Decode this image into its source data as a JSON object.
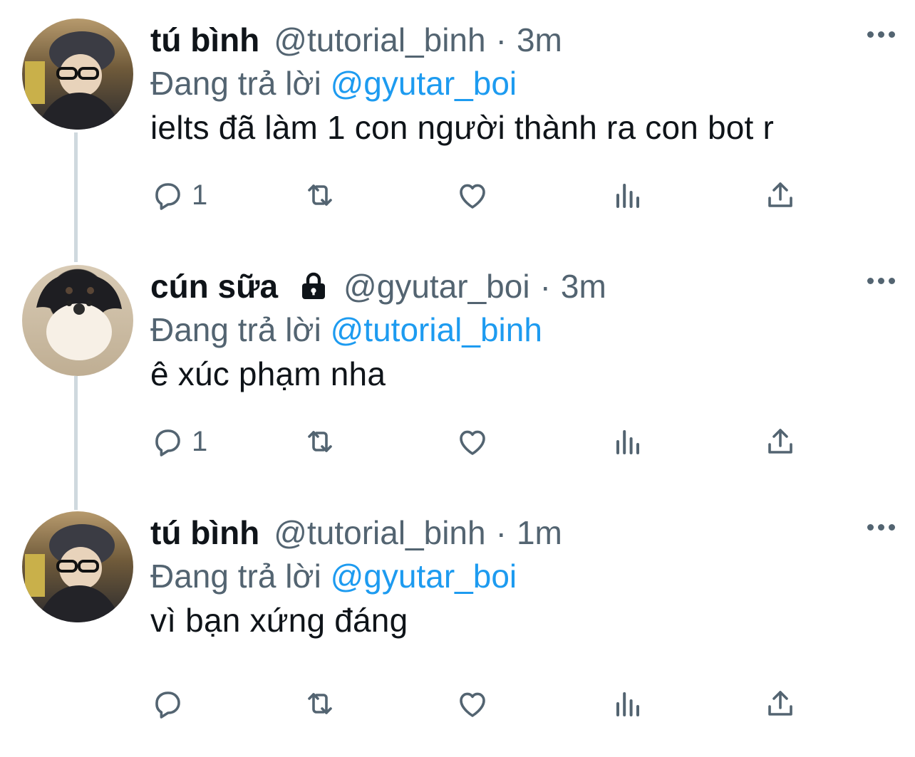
{
  "tweets": [
    {
      "name": "tú bình",
      "handle": "@tutorial_binh",
      "dot": "·",
      "time": "3m",
      "reply_prefix": "Đang trả lời",
      "reply_to": "@gyutar_boi",
      "text": "ielts đã làm 1 con người thành ra con bot r",
      "reply_count": "1",
      "locked": false
    },
    {
      "name": "cún sữa",
      "handle": "@gyutar_boi",
      "dot": "·",
      "time": "3m",
      "reply_prefix": "Đang trả lời",
      "reply_to": "@tutorial_binh",
      "text": "ê xúc phạm nha",
      "reply_count": "1",
      "locked": true
    },
    {
      "name": "tú bình",
      "handle": "@tutorial_binh",
      "dot": "·",
      "time": "1m",
      "reply_prefix": "Đang trả lời",
      "reply_to": "@gyutar_boi",
      "text": "vì bạn xứng đáng",
      "reply_count": "",
      "locked": false
    }
  ],
  "colors": {
    "mention": "#1d9bf0",
    "muted": "#536471",
    "text": "#0f1419",
    "thread_line": "#cfd9de"
  },
  "icons": [
    "reply-icon",
    "retweet-icon",
    "like-icon",
    "analytics-icon",
    "share-icon",
    "more-icon",
    "lock-icon"
  ]
}
